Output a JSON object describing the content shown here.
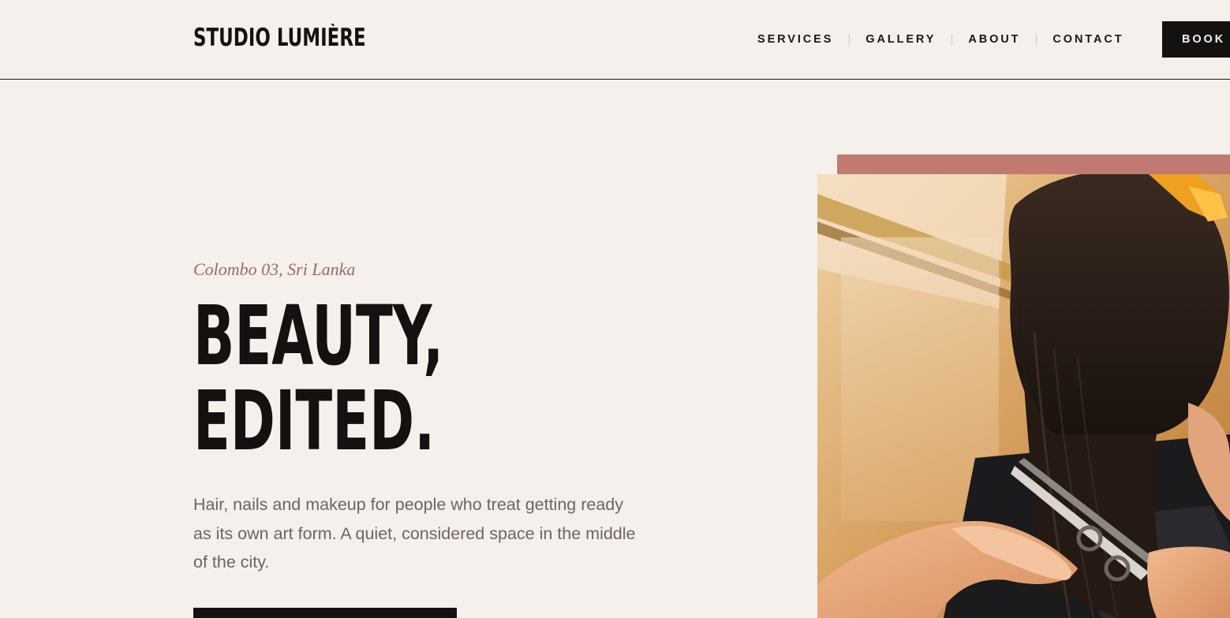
{
  "brand": {
    "name": "STUDIO LUMIÈRE"
  },
  "nav": {
    "items": [
      {
        "label": "SERVICES"
      },
      {
        "label": "GALLERY"
      },
      {
        "label": "ABOUT"
      },
      {
        "label": "CONTACT"
      }
    ],
    "book_label": "BOOK"
  },
  "hero": {
    "location": "Colombo 03, Sri Lanka",
    "headline_line1": "BEAUTY,",
    "headline_line2": "EDITED.",
    "description": "Hair, nails and makeup for people who treat getting ready as its own art form. A quiet, considered space in the middle of the city.",
    "image_alt": "Stylist cutting a client's long dark hair with scissors"
  },
  "colors": {
    "background": "#f5f0eb",
    "ink": "#141111",
    "accent": "#c07a72",
    "eyebrow": "#9a6a66",
    "body_text": "#6e6560"
  }
}
